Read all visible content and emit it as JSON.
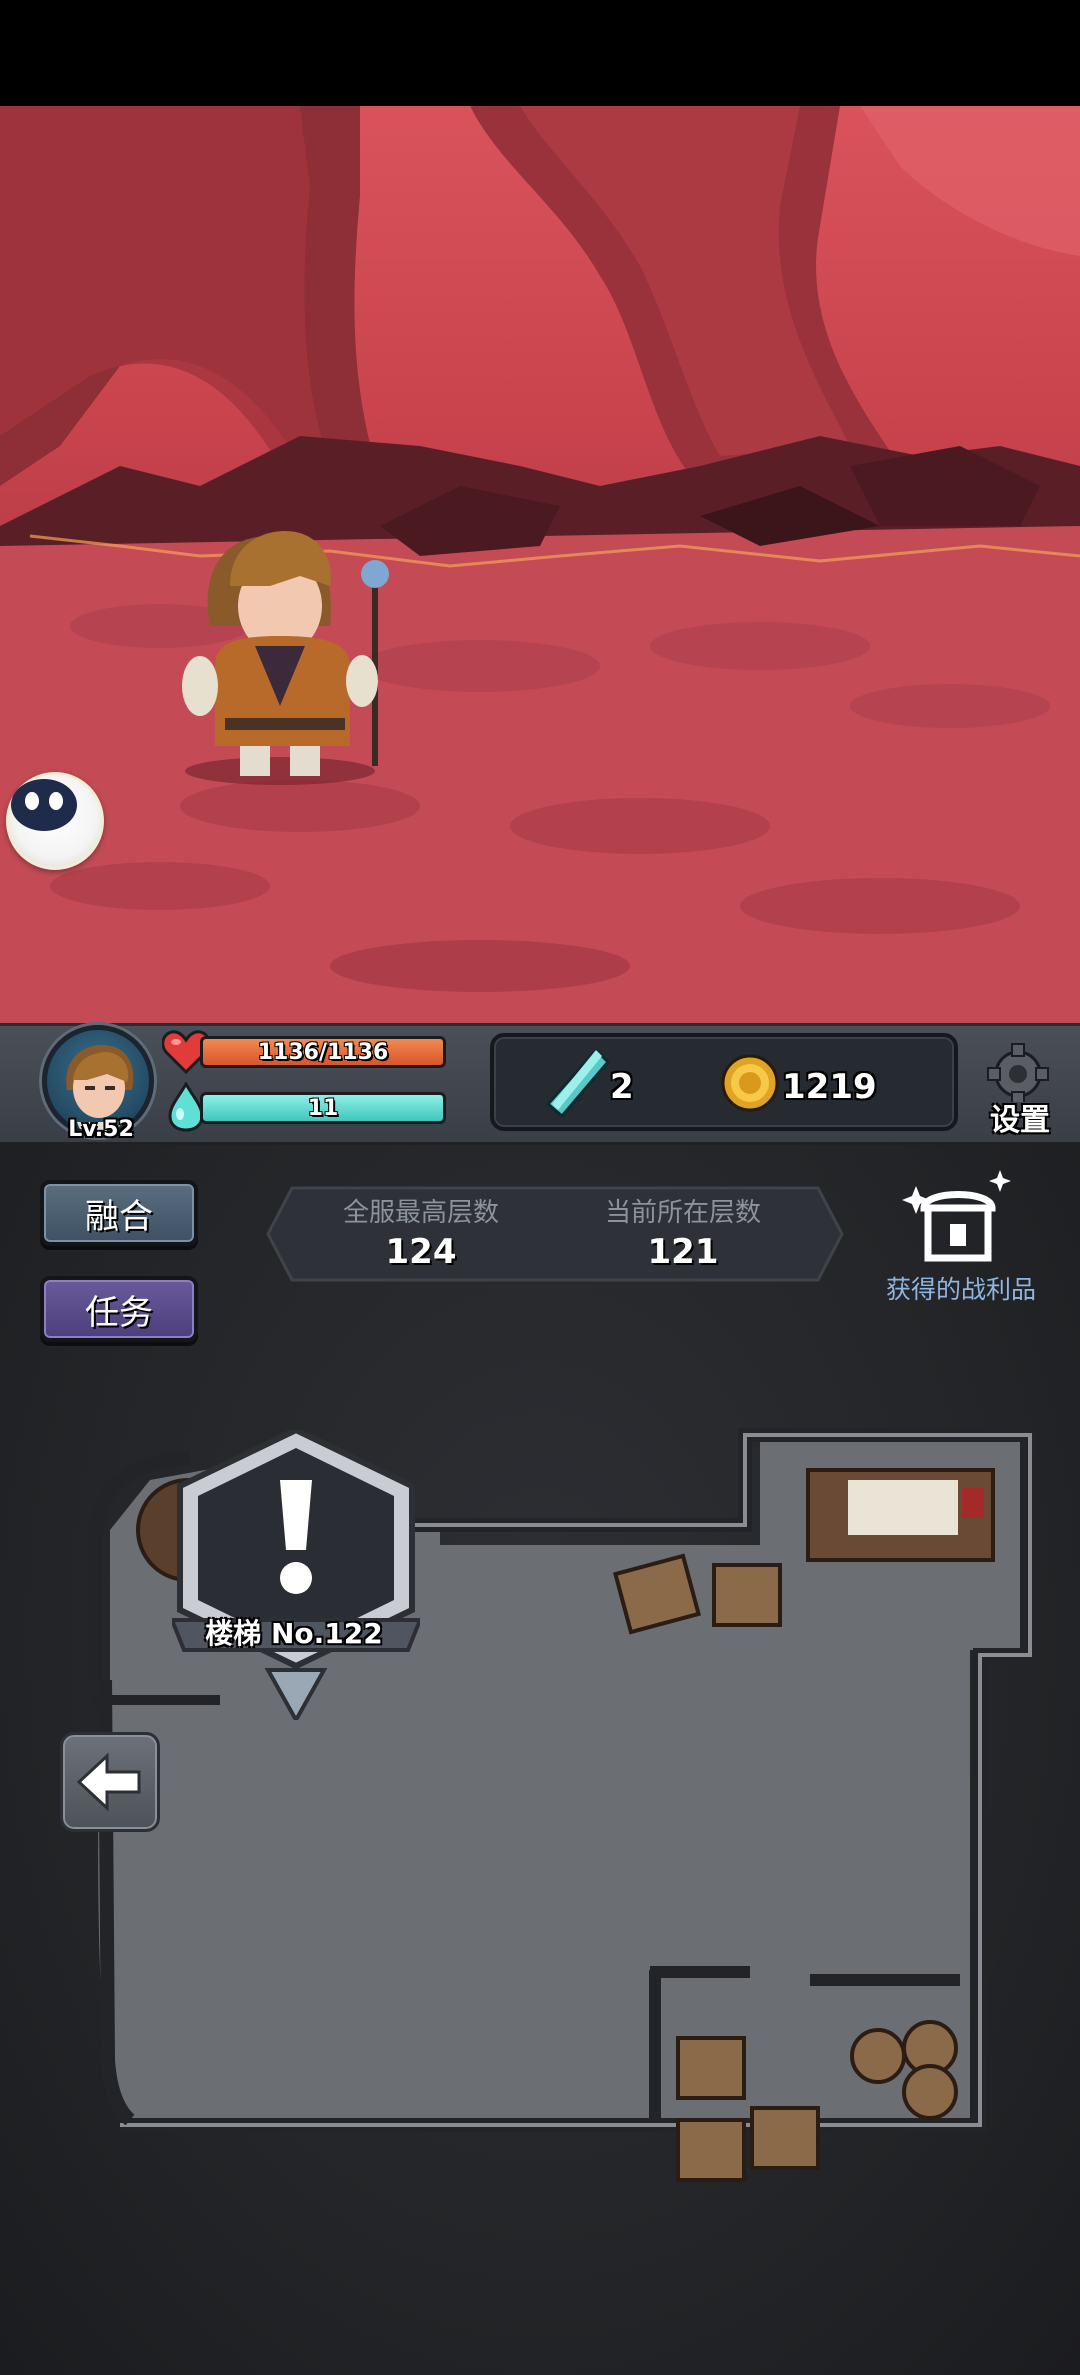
{
  "player": {
    "level_label": "Lv.52",
    "hp_text": "1136/1136",
    "hp_fraction": 1.0,
    "mp_text": "11",
    "mp_fraction": 1.0
  },
  "resources": {
    "crystal_count": "2",
    "gold_count": "1219"
  },
  "settings_label": "设置",
  "buttons": {
    "fuse_label": "融合",
    "task_label": "任务"
  },
  "floors": {
    "server_best_label": "全服最高层数",
    "server_best_value": "124",
    "current_label": "当前所在层数",
    "current_value": "121"
  },
  "loot_label": "获得的战利品",
  "stairs_label": "楼梯 No.122",
  "icons": {
    "pet": "pet-ghost-icon",
    "hp": "heart-icon",
    "mp": "mana-drop-icon",
    "crystal": "crystal-icon",
    "gold": "gold-coin-icon",
    "settings": "gear-icon",
    "loot": "treasure-chest-icon",
    "stairs": "exclamation-icon",
    "back": "arrow-left-icon"
  },
  "colors": {
    "hp": "#d9552b",
    "mp": "#3fc7bd",
    "task_button": "#4c3f7c",
    "fuse_button": "#3f5164",
    "loot_text": "#8fb6e0"
  }
}
